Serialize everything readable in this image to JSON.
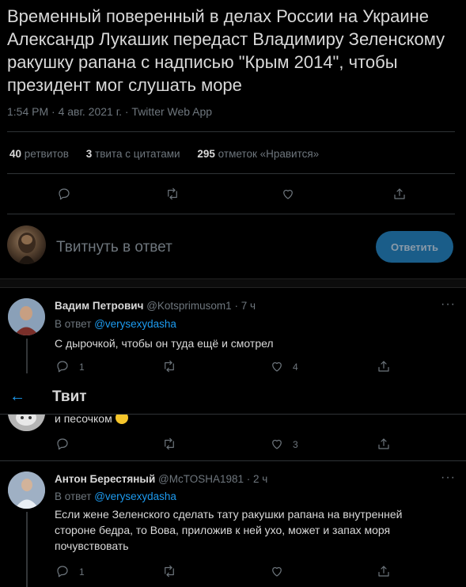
{
  "tweet": {
    "text": "Временный поверенный в делах России на Украине Александр Лукашик передаст Владимиру Зеленскому ракушку рапана с надписью \"Крым 2014\", чтобы президент мог слушать море",
    "meta": "1:54 PM · 4 авг. 2021 г. · Twitter Web App",
    "stats": {
      "retweets_count": "40",
      "retweets_label": "ретвитов",
      "quotes_count": "3",
      "quotes_label": "твита с цитатами",
      "likes_count": "295",
      "likes_label": "отметок «Нравится»"
    }
  },
  "composer": {
    "placeholder": "Твитнуть в ответ",
    "button": "Ответить"
  },
  "header": {
    "title": "Твит"
  },
  "replies": [
    {
      "name": "Вадим Петрович",
      "handle": "@Kotsprimusom1",
      "time": "· 7 ч",
      "reply_to_label": "В ответ",
      "reply_to": "@verysexydasha",
      "text": "С дырочкой, чтобы он туда ещё и смотрел",
      "reply_count": "1",
      "like_count": "4"
    },
    {
      "text": "и песочком",
      "like_count": "3"
    },
    {
      "name": "Антон Берестяный",
      "handle": "@McTOSHA1981",
      "time": "· 2 ч",
      "reply_to_label": "В ответ",
      "reply_to": "@verysexydasha",
      "text": "Если жене Зеленского сделать тату ракушки рапана на внутренней стороне бедра, то Вова, приложив к ней ухо, может и запах моря почувствовать",
      "reply_count": "1"
    }
  ],
  "icons": {
    "more": "more-icon",
    "reply": "reply-icon",
    "retweet": "retweet-icon",
    "like": "like-icon",
    "share": "share-icon",
    "back": "back-arrow-icon"
  },
  "colors": {
    "background": "#000000",
    "text": "#d9d9d9",
    "muted": "#6e767d",
    "accent": "#1d9bf0",
    "reply_button": "#1a5d89"
  }
}
